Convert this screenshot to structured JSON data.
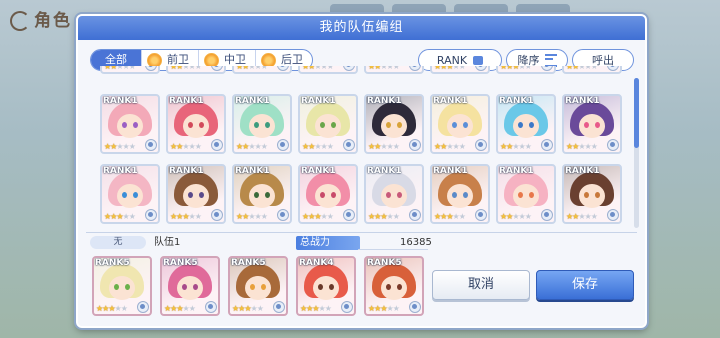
{
  "background": {
    "title": "角色"
  },
  "modal": {
    "title": "我的队伍编组",
    "filters": [
      "全部",
      "前卫",
      "中卫",
      "后卫"
    ],
    "sort_field": "RANK",
    "sort_order": "降序",
    "call_label": "呼出"
  },
  "roster": [
    {
      "rank": "RANK1",
      "stars": 2,
      "hair": "#f3a9b8",
      "eye": "#9b5fc4"
    },
    {
      "rank": "RANK1",
      "stars": 2,
      "hair": "#e8657a",
      "eye": "#d24a5a"
    },
    {
      "rank": "RANK1",
      "stars": 2,
      "hair": "#9fe0c6",
      "eye": "#3d9c7e"
    },
    {
      "rank": "RANK1",
      "stars": 2,
      "hair": "#e8e6a8",
      "eye": "#6aa64a"
    },
    {
      "rank": "RANK1",
      "stars": 2,
      "hair": "#2e2a3a",
      "eye": "#d8a33a"
    },
    {
      "rank": "RANK1",
      "stars": 2,
      "hair": "#f5e2a0",
      "eye": "#5a8fd8"
    },
    {
      "rank": "RANK1",
      "stars": 2,
      "hair": "#6ac8e8",
      "eye": "#3a78c8"
    },
    {
      "rank": "RANK1",
      "stars": 2,
      "hair": "#6a4a9a",
      "eye": "#e85a8a"
    },
    {
      "rank": "RANK1",
      "stars": 3,
      "hair": "#f4b6c4",
      "eye": "#3a8ed8"
    },
    {
      "rank": "RANK1",
      "stars": 3,
      "hair": "#8a5a3a",
      "eye": "#5a4a8a"
    },
    {
      "rank": "RANK1",
      "stars": 2,
      "hair": "#b88a4a",
      "eye": "#3a6a3a"
    },
    {
      "rank": "RANK1",
      "stars": 3,
      "hair": "#f28ea8",
      "eye": "#c84a6a"
    },
    {
      "rank": "RANK1",
      "stars": 3,
      "hair": "#d8dae6",
      "eye": "#c85a7a"
    },
    {
      "rank": "RANK1",
      "stars": 3,
      "hair": "#c8804a",
      "eye": "#5a8ac8"
    },
    {
      "rank": "RANK1",
      "stars": 2,
      "hair": "#f6b2c2",
      "eye": "#e8784a"
    },
    {
      "rank": "RANK1",
      "stars": 2,
      "hair": "#6a4030",
      "eye": "#c8783a"
    }
  ],
  "team": {
    "label": "无",
    "name": "队伍1",
    "power_label": "总战力",
    "power_value": "16385",
    "members": [
      {
        "rank": "RANK5",
        "stars": 3,
        "hair": "#f0e6b0",
        "eye": "#6ab04a"
      },
      {
        "rank": "RANK5",
        "stars": 3,
        "hair": "#e06a9a",
        "eye": "#a84a8a"
      },
      {
        "rank": "RANK5",
        "stars": 3,
        "hair": "#a86a3a",
        "eye": "#e8a03a"
      },
      {
        "rank": "RANK4",
        "stars": 3,
        "hair": "#e85a4a",
        "eye": "#6a3a2a"
      },
      {
        "rank": "RANK5",
        "stars": 3,
        "hair": "#d8603a",
        "eye": "#7a3a2a"
      }
    ]
  },
  "buttons": {
    "cancel": "取消",
    "save": "保存"
  }
}
